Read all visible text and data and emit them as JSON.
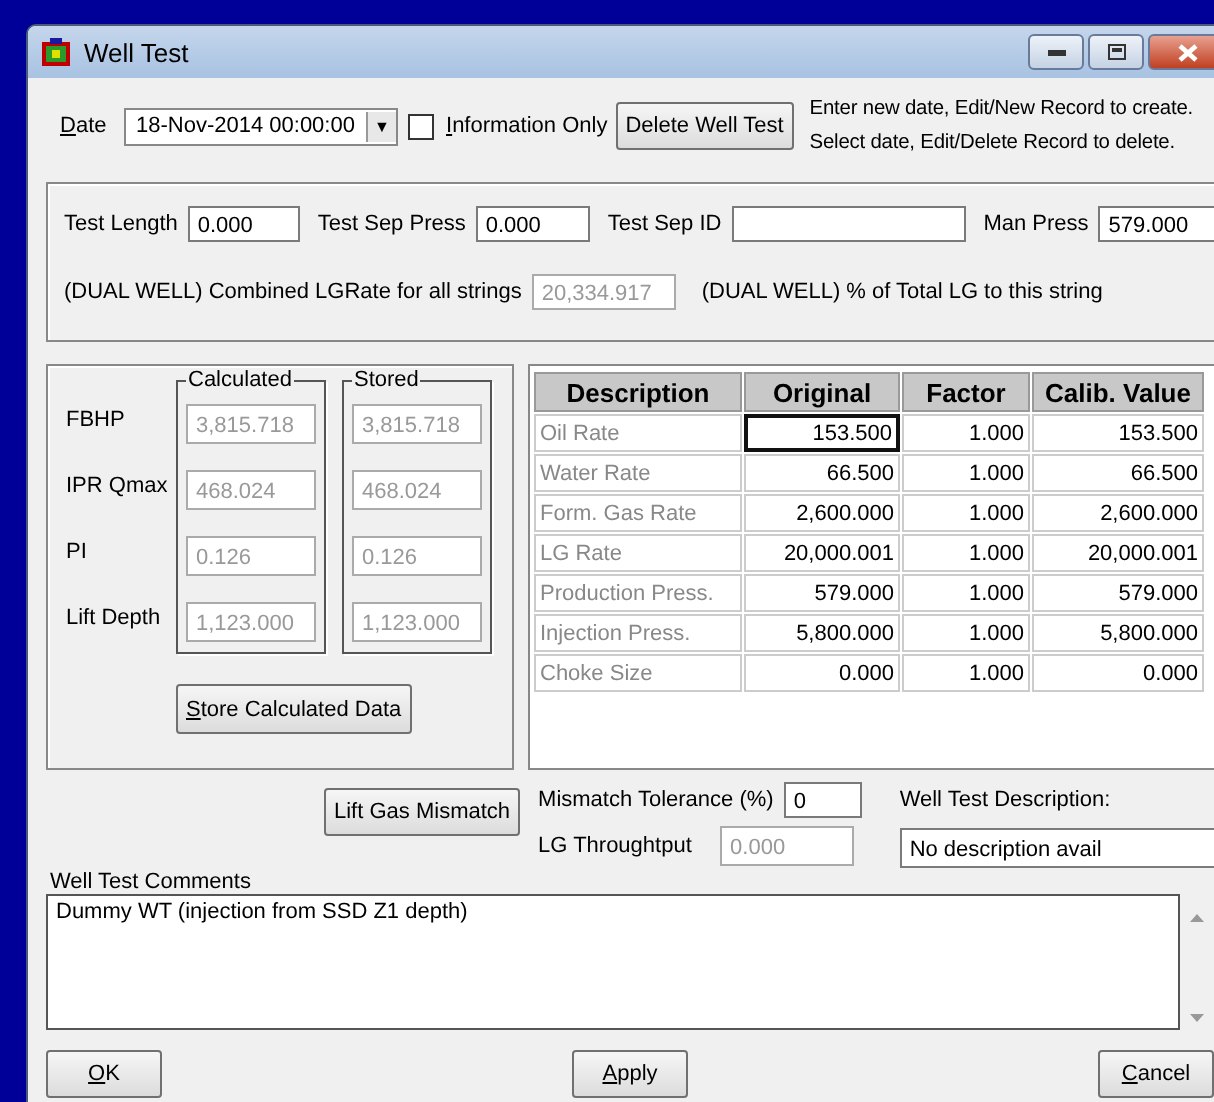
{
  "window": {
    "title": "Well Test"
  },
  "header": {
    "date_label": "Date",
    "date_value": "18-Nov-2014 00:00:00",
    "dropdown_arrow": "▼",
    "info_only": {
      "label": "Information Only",
      "checked": false
    },
    "delete_button": "Delete Well Test",
    "instructions": [
      "Enter new date, Edit/New Record to create.",
      "Select date, Edit/Delete Record to delete."
    ]
  },
  "test_params": [
    {
      "label": "Test Length",
      "value": "0.000",
      "disabled": false
    },
    {
      "label": "Test Sep Press",
      "value": "0.000",
      "disabled": false
    },
    {
      "label": "Test Sep ID",
      "disabled": false
    },
    {
      "label": "Man Press",
      "value": "579.000",
      "disabled": false
    }
  ],
  "dual_well": {
    "combined_label": "(DUAL WELL) Combined LGRate for all strings",
    "combined_value": "20,334.917",
    "combined_disabled": true,
    "percent_label": "(DUAL WELL) % of Total LG to this string"
  },
  "calc_panel": {
    "calculated_title": "Calculated",
    "stored_title": "Stored",
    "store_button": "Store Calculated Data",
    "rows": [
      {
        "label": "FBHP",
        "calculated": "3,815.718",
        "stored": "3,815.718",
        "disabled": true
      },
      {
        "label": "IPR Qmax",
        "calculated": "468.024",
        "stored": "468.024",
        "disabled": true
      },
      {
        "label": "PI",
        "calculated": "0.126",
        "stored": "0.126",
        "disabled": true
      },
      {
        "label": "Lift Depth",
        "calculated": "1,123.000",
        "stored": "1,123.000",
        "disabled": true
      }
    ]
  },
  "table": {
    "columns": [
      "Description",
      "Original",
      "Factor",
      "Calib. Value"
    ],
    "rows": [
      {
        "cells": [
          "Oil Rate",
          "153.500",
          "1.000",
          "153.500"
        ],
        "selected": true
      },
      {
        "cells": [
          "Water Rate",
          "66.500",
          "1.000",
          "66.500"
        ],
        "selected": false
      },
      {
        "cells": [
          "Form. Gas Rate",
          "2,600.000",
          "1.000",
          "2,600.000"
        ],
        "selected": false
      },
      {
        "cells": [
          "LG Rate",
          "20,000.001",
          "1.000",
          "20,000.001"
        ],
        "selected": false
      },
      {
        "cells": [
          "Production Press.",
          "579.000",
          "1.000",
          "579.000"
        ],
        "selected": false
      },
      {
        "cells": [
          "Injection Press.",
          "5,800.000",
          "1.000",
          "5,800.000"
        ],
        "selected": false
      },
      {
        "cells": [
          "Choke Size",
          "0.000",
          "1.000",
          "0.000"
        ],
        "selected": false
      }
    ]
  },
  "mismatch": {
    "button": "Lift Gas Mismatch",
    "tolerance_label": "Mismatch Tolerance (%)",
    "tolerance_value": "0",
    "throughput_label": "LG Throughtput",
    "throughput_value": "0.000",
    "throughput_disabled": true,
    "description_label": "Well Test Description:",
    "description_value": "No description avail"
  },
  "comments": {
    "label": "Well Test Comments",
    "value": "Dummy WT (injection from SSD Z1 depth)"
  },
  "buttons": [
    "OK",
    "Apply",
    "Cancel"
  ]
}
